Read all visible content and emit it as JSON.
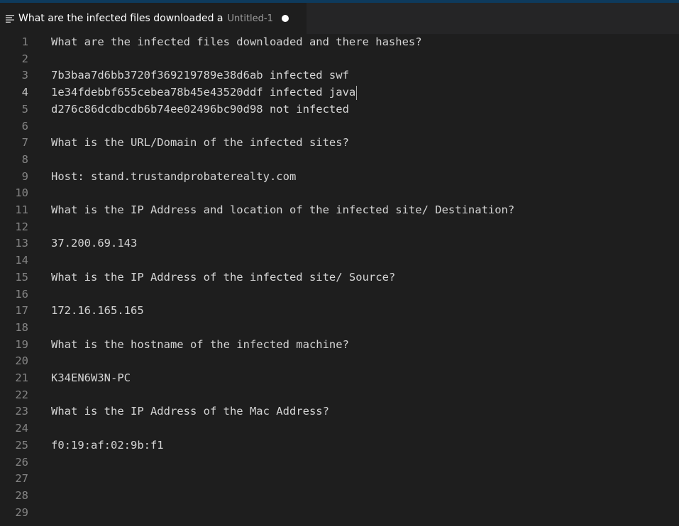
{
  "tab": {
    "icon": "text-lines-icon",
    "title": "What are the infected files downloaded a",
    "subtitle": "Untitled-1",
    "modified": true
  },
  "editor": {
    "active_line": 4,
    "lines": [
      {
        "num": "1",
        "text": "What are the infected files downloaded and there hashes?"
      },
      {
        "num": "2",
        "text": ""
      },
      {
        "num": "3",
        "text": "7b3baa7d6bb3720f369219789e38d6ab infected swf"
      },
      {
        "num": "4",
        "text": "1e34fdebbf655cebea78b45e43520ddf infected java"
      },
      {
        "num": "5",
        "text": "d276c86dcdbcdb6b74ee02496bc90d98 not infected"
      },
      {
        "num": "6",
        "text": ""
      },
      {
        "num": "7",
        "text": "What is the URL/Domain of the infected sites?"
      },
      {
        "num": "8",
        "text": ""
      },
      {
        "num": "9",
        "text": "Host: stand.trustandprobaterealty.com"
      },
      {
        "num": "10",
        "text": ""
      },
      {
        "num": "11",
        "text": "What is the IP Address and location of the infected site/ Destination?"
      },
      {
        "num": "12",
        "text": ""
      },
      {
        "num": "13",
        "text": "37.200.69.143"
      },
      {
        "num": "14",
        "text": ""
      },
      {
        "num": "15",
        "text": "What is the IP Address of the infected site/ Source?"
      },
      {
        "num": "16",
        "text": ""
      },
      {
        "num": "17",
        "text": "172.16.165.165"
      },
      {
        "num": "18",
        "text": ""
      },
      {
        "num": "19",
        "text": "What is the hostname of the infected machine?"
      },
      {
        "num": "20",
        "text": ""
      },
      {
        "num": "21",
        "text": "K34EN6W3N-PC"
      },
      {
        "num": "22",
        "text": ""
      },
      {
        "num": "23",
        "text": "What is the IP Address of the Mac Address?"
      },
      {
        "num": "24",
        "text": ""
      },
      {
        "num": "25",
        "text": "f0:19:af:02:9b:f1"
      },
      {
        "num": "26",
        "text": ""
      },
      {
        "num": "27",
        "text": ""
      },
      {
        "num": "28",
        "text": ""
      },
      {
        "num": "29",
        "text": ""
      }
    ]
  },
  "colors": {
    "background": "#1e1e1e",
    "text": "#d4d4d4",
    "line_number": "#858585",
    "active_line_number": "#c6c6c6"
  }
}
